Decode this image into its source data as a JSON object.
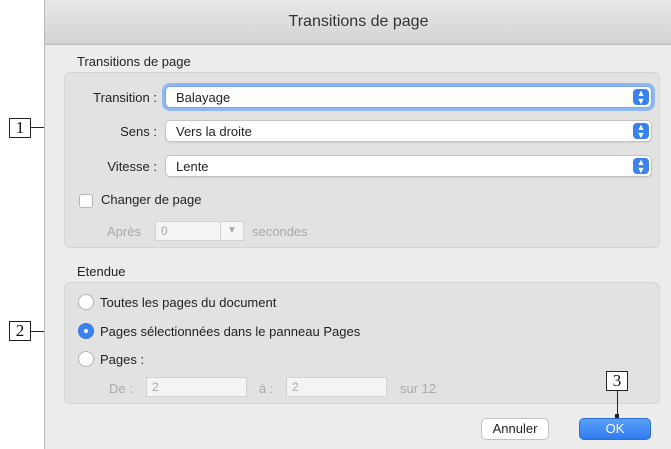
{
  "window": {
    "title": "Transitions de page"
  },
  "transitions_group": {
    "title": "Transitions de page",
    "transition": {
      "label": "Transition :",
      "value": "Balayage"
    },
    "sens": {
      "label": "Sens :",
      "value": "Vers la droite"
    },
    "vitesse": {
      "label": "Vitesse :",
      "value": "Lente"
    },
    "changer_page": {
      "label": "Changer de page",
      "checked": false
    },
    "apres": {
      "label": "Après",
      "value": "0",
      "unit": "secondes"
    }
  },
  "etendue_group": {
    "title": "Etendue",
    "options": [
      {
        "label": "Toutes les pages du document",
        "selected": false
      },
      {
        "label": "Pages sélectionnées dans le panneau Pages",
        "selected": true
      },
      {
        "label": "Pages :",
        "selected": false
      }
    ],
    "range": {
      "from_label": "De :",
      "from_value": "2",
      "to_label": "à :",
      "to_value": "2",
      "total": "sur 12"
    }
  },
  "buttons": {
    "cancel": "Annuler",
    "ok": "OK"
  },
  "callouts": {
    "one": "1",
    "two": "2",
    "three": "3"
  },
  "colors": {
    "accent": "#3b82f1",
    "dialog_bg": "#ececec"
  }
}
